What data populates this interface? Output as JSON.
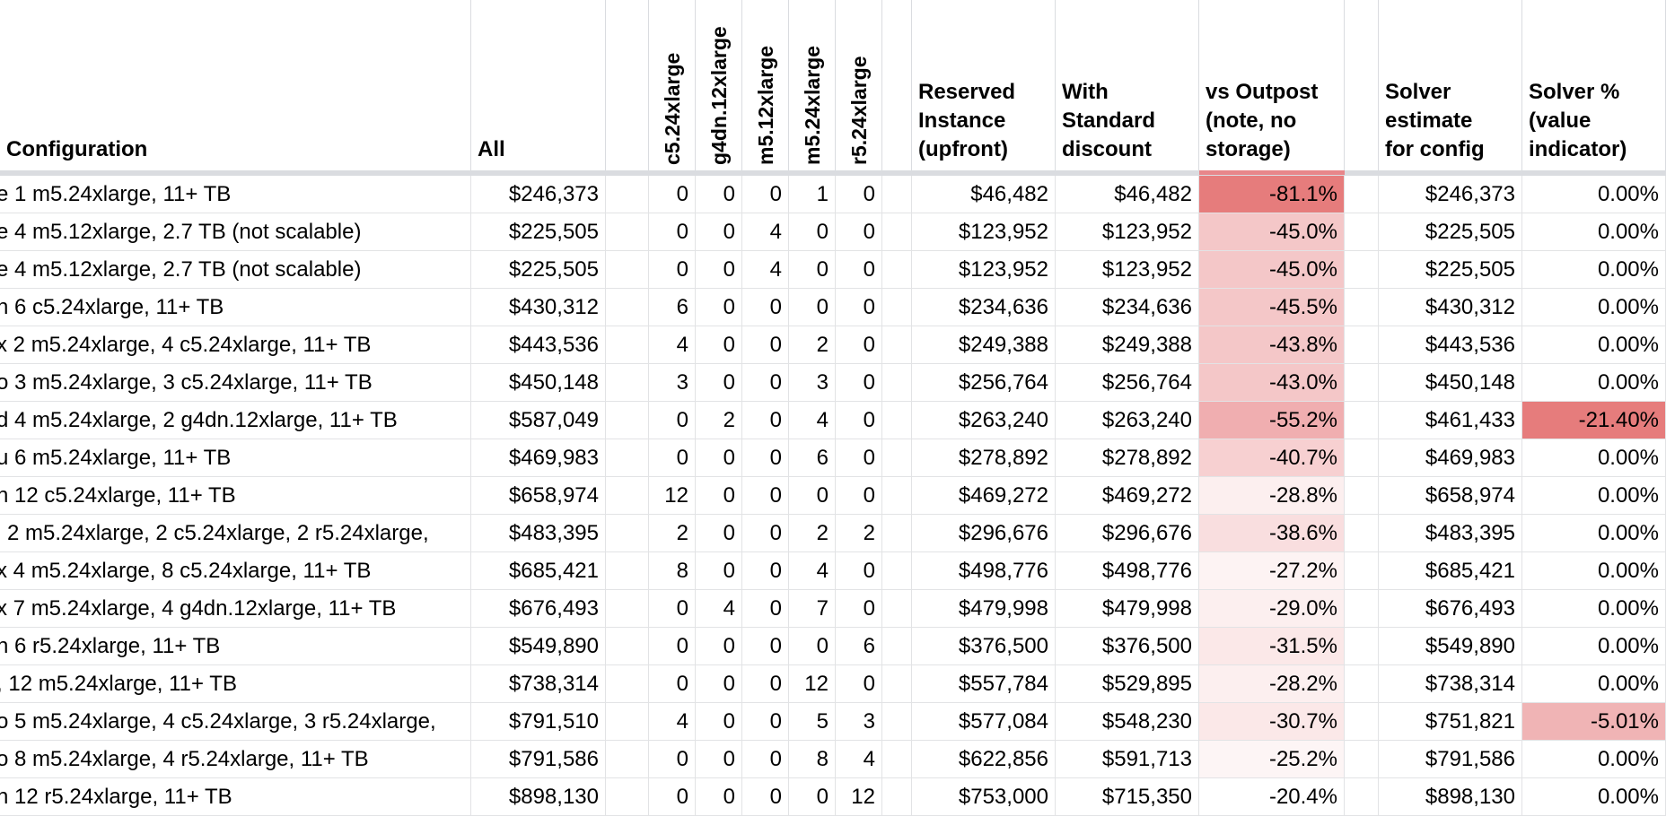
{
  "headers": {
    "configuration": "Configuration",
    "all": "All",
    "c5": "c5.24xlarge",
    "g4dn": "g4dn.12xlarge",
    "m512": "m5.12xlarge",
    "m524": "m5.24xlarge",
    "r5": "r5.24xlarge",
    "reserved": "Reserved\nInstance\n(upfront)",
    "standard": "With\nStandard\ndiscount",
    "vs_outpost": "vs Outpost\n(note, no\nstorage)",
    "solver_est": "Solver\nestimate\nfor config",
    "solver_pct": "Solver %\n(value\nindicator)"
  },
  "colors": {
    "vs_strong": "#e67c7c",
    "vs_medium": "#f0aeb0",
    "vs_light": "#f4c7c8",
    "vs_pale": "#f9dedf",
    "vs_faint": "#fcefef",
    "solver_strong": "#e67c7c",
    "solver_light": "#f0b4b5"
  },
  "rows": [
    {
      "prefix": "e",
      "config": "1 m5.24xlarge, 11+ TB",
      "all": "$246,373",
      "c5": "0",
      "g4dn": "0",
      "m512": "0",
      "m524": "1",
      "r5": "0",
      "reserved": "$46,482",
      "standard": "$46,482",
      "vs": "-81.1%",
      "vs_color": "#e67c7c",
      "solver": "$246,373",
      "pct": "0.00%",
      "pct_color": ""
    },
    {
      "prefix": "e",
      "config": "4 m5.12xlarge, 2.7 TB (not scalable)",
      "all": "$225,505",
      "c5": "0",
      "g4dn": "0",
      "m512": "4",
      "m524": "0",
      "r5": "0",
      "reserved": "$123,952",
      "standard": "$123,952",
      "vs": "-45.0%",
      "vs_color": "#f4c7c8",
      "solver": "$225,505",
      "pct": "0.00%",
      "pct_color": ""
    },
    {
      "prefix": "e",
      "config": "4 m5.12xlarge, 2.7 TB (not scalable)",
      "all": "$225,505",
      "c5": "0",
      "g4dn": "0",
      "m512": "4",
      "m524": "0",
      "r5": "0",
      "reserved": "$123,952",
      "standard": "$123,952",
      "vs": "-45.0%",
      "vs_color": "#f4c7c8",
      "solver": "$225,505",
      "pct": "0.00%",
      "pct_color": ""
    },
    {
      "prefix": "n",
      "config": "6 c5.24xlarge, 11+ TB",
      "all": "$430,312",
      "c5": "6",
      "g4dn": "0",
      "m512": "0",
      "m524": "0",
      "r5": "0",
      "reserved": "$234,636",
      "standard": "$234,636",
      "vs": "-45.5%",
      "vs_color": "#f4c7c8",
      "solver": "$430,312",
      "pct": "0.00%",
      "pct_color": ""
    },
    {
      "prefix": "x",
      "config": "2 m5.24xlarge, 4 c5.24xlarge, 11+ TB",
      "all": "$443,536",
      "c5": "4",
      "g4dn": "0",
      "m512": "0",
      "m524": "2",
      "r5": "0",
      "reserved": "$249,388",
      "standard": "$249,388",
      "vs": "-43.8%",
      "vs_color": "#f4c7c8",
      "solver": "$443,536",
      "pct": "0.00%",
      "pct_color": ""
    },
    {
      "prefix": "o",
      "config": "3 m5.24xlarge, 3 c5.24xlarge, 11+ TB",
      "all": "$450,148",
      "c5": "3",
      "g4dn": "0",
      "m512": "0",
      "m524": "3",
      "r5": "0",
      "reserved": "$256,764",
      "standard": "$256,764",
      "vs": "-43.0%",
      "vs_color": "#f4c7c8",
      "solver": "$450,148",
      "pct": "0.00%",
      "pct_color": ""
    },
    {
      "prefix": "d",
      "config": "4 m5.24xlarge, 2 g4dn.12xlarge, 11+ TB",
      "all": "$587,049",
      "c5": "0",
      "g4dn": "2",
      "m512": "0",
      "m524": "4",
      "r5": "0",
      "reserved": "$263,240",
      "standard": "$263,240",
      "vs": "-55.2%",
      "vs_color": "#f0aeb0",
      "solver": "$461,433",
      "pct": "-21.40%",
      "pct_color": "#e67c7c"
    },
    {
      "prefix": "u",
      "config": "6 m5.24xlarge, 11+ TB",
      "all": "$469,983",
      "c5": "0",
      "g4dn": "0",
      "m512": "0",
      "m524": "6",
      "r5": "0",
      "reserved": "$278,892",
      "standard": "$278,892",
      "vs": "-40.7%",
      "vs_color": "#f7d0d1",
      "solver": "$469,983",
      "pct": "0.00%",
      "pct_color": ""
    },
    {
      "prefix": "n",
      "config": "12 c5.24xlarge, 11+ TB",
      "all": "$658,974",
      "c5": "12",
      "g4dn": "0",
      "m512": "0",
      "m524": "0",
      "r5": "0",
      "reserved": "$469,272",
      "standard": "$469,272",
      "vs": "-28.8%",
      "vs_color": "#fcefef",
      "solver": "$658,974",
      "pct": "0.00%",
      "pct_color": ""
    },
    {
      "prefix": "i",
      "config": "2 m5.24xlarge, 2 c5.24xlarge, 2 r5.24xlarge,",
      "all": "$483,395",
      "c5": "2",
      "g4dn": "0",
      "m512": "0",
      "m524": "2",
      "r5": "2",
      "reserved": "$296,676",
      "standard": "$296,676",
      "vs": "-38.6%",
      "vs_color": "#f9dedf",
      "solver": "$483,395",
      "pct": "0.00%",
      "pct_color": ""
    },
    {
      "prefix": "x",
      "config": "4 m5.24xlarge, 8 c5.24xlarge, 11+ TB",
      "all": "$685,421",
      "c5": "8",
      "g4dn": "0",
      "m512": "0",
      "m524": "4",
      "r5": "0",
      "reserved": "$498,776",
      "standard": "$498,776",
      "vs": "-27.2%",
      "vs_color": "#fdf3f3",
      "solver": "$685,421",
      "pct": "0.00%",
      "pct_color": ""
    },
    {
      "prefix": "x",
      "config": "7 m5.24xlarge, 4 g4dn.12xlarge, 11+ TB",
      "all": "$676,493",
      "c5": "0",
      "g4dn": "4",
      "m512": "0",
      "m524": "7",
      "r5": "0",
      "reserved": "$479,998",
      "standard": "$479,998",
      "vs": "-29.0%",
      "vs_color": "#fcefef",
      "solver": "$676,493",
      "pct": "0.00%",
      "pct_color": ""
    },
    {
      "prefix": "n",
      "config": "6 r5.24xlarge, 11+ TB",
      "all": "$549,890",
      "c5": "0",
      "g4dn": "0",
      "m512": "0",
      "m524": "0",
      "r5": "6",
      "reserved": "$376,500",
      "standard": "$376,500",
      "vs": "-31.5%",
      "vs_color": "#fbe8e8",
      "solver": "$549,890",
      "pct": "0.00%",
      "pct_color": ""
    },
    {
      "prefix": ",",
      "config": "12 m5.24xlarge, 11+ TB",
      "all": "$738,314",
      "c5": "0",
      "g4dn": "0",
      "m512": "0",
      "m524": "12",
      "r5": "0",
      "reserved": "$557,784",
      "standard": "$529,895",
      "vs": "-28.2%",
      "vs_color": "#fcefef",
      "solver": "$738,314",
      "pct": "0.00%",
      "pct_color": ""
    },
    {
      "prefix": "o",
      "config": "5 m5.24xlarge, 4 c5.24xlarge, 3 r5.24xlarge,",
      "all": "$791,510",
      "c5": "4",
      "g4dn": "0",
      "m512": "0",
      "m524": "5",
      "r5": "3",
      "reserved": "$577,084",
      "standard": "$548,230",
      "vs": "-30.7%",
      "vs_color": "#fbe8e8",
      "solver": "$751,821",
      "pct": "-5.01%",
      "pct_color": "#f0b4b5"
    },
    {
      "prefix": "o",
      "config": "8 m5.24xlarge, 4 r5.24xlarge, 11+ TB",
      "all": "$791,586",
      "c5": "0",
      "g4dn": "0",
      "m512": "0",
      "m524": "8",
      "r5": "4",
      "reserved": "$622,856",
      "standard": "$591,713",
      "vs": "-25.2%",
      "vs_color": "#fdf5f5",
      "solver": "$791,586",
      "pct": "0.00%",
      "pct_color": ""
    },
    {
      "prefix": "n",
      "config": "12 r5.24xlarge, 11+ TB",
      "all": "$898,130",
      "c5": "0",
      "g4dn": "0",
      "m512": "0",
      "m524": "0",
      "r5": "12",
      "reserved": "$753,000",
      "standard": "$715,350",
      "vs": "-20.4%",
      "vs_color": "#ffffff",
      "solver": "$898,130",
      "pct": "0.00%",
      "pct_color": ""
    }
  ]
}
